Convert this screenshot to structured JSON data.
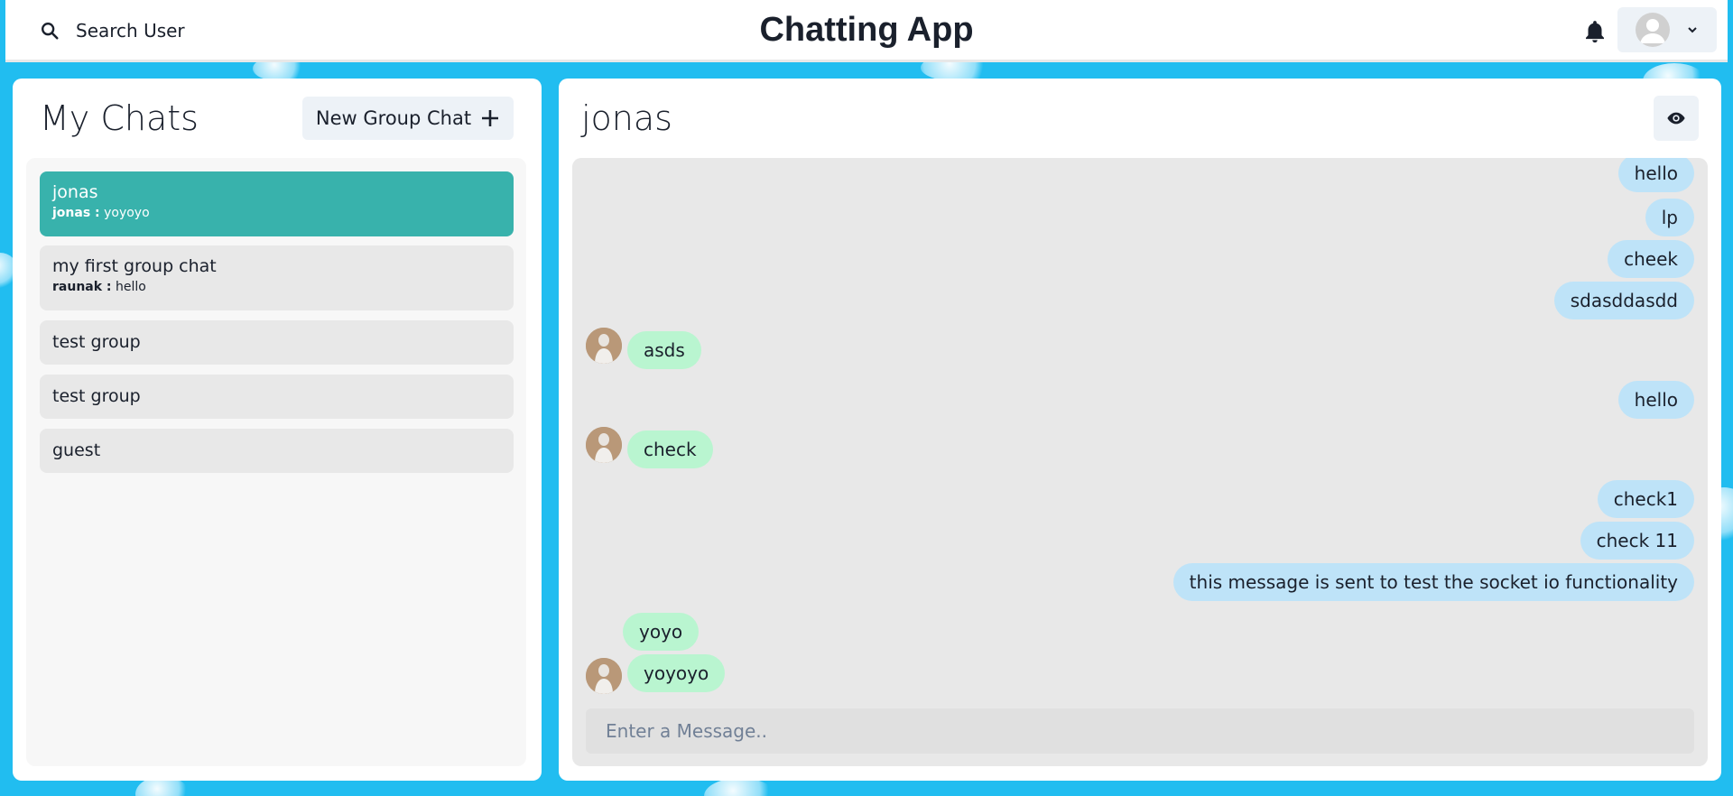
{
  "header": {
    "search_label": "Search User",
    "title": "Chatting App",
    "icons": {
      "search": "search-icon",
      "notification": "bell-icon",
      "profile": "user-avatar-icon",
      "dropdown": "chevron-down-icon"
    }
  },
  "sidebar": {
    "title": "My Chats",
    "new_group_label": "New Group Chat",
    "chats": [
      {
        "name": "jonas",
        "latest_sender": "jonas :",
        "latest_text": " yoyoyo",
        "active": true
      },
      {
        "name": "my first group chat",
        "latest_sender": "raunak :",
        "latest_text": " hello",
        "active": false
      },
      {
        "name": "test group",
        "active": false
      },
      {
        "name": "test group",
        "active": false
      },
      {
        "name": "guest",
        "active": false
      }
    ]
  },
  "chat": {
    "name": "jonas",
    "view_profile_icon": "eye-icon",
    "messages": [
      {
        "text": "hello",
        "side": "sent"
      },
      {
        "text": "lp",
        "side": "sent"
      },
      {
        "text": "cheek",
        "side": "sent"
      },
      {
        "text": "sdasddasdd",
        "side": "sent"
      },
      {
        "text": "asds",
        "side": "recv",
        "avatar": true
      },
      {
        "text": "hello",
        "side": "sent"
      },
      {
        "text": "check",
        "side": "recv",
        "avatar": true
      },
      {
        "text": "check1",
        "side": "sent"
      },
      {
        "text": "check 11",
        "side": "sent"
      },
      {
        "text": "this message is sent to test the socket io functionality",
        "side": "sent"
      },
      {
        "text": "yoyo",
        "side": "recv",
        "avatar": false
      },
      {
        "text": "yoyoyo",
        "side": "recv",
        "avatar": true
      }
    ],
    "input_placeholder": "Enter a Message..",
    "input_value": ""
  },
  "colors": {
    "background": "#21bdf0",
    "active_chat": "#38b2ac",
    "sent_bubble": "#bee3f8",
    "received_bubble": "#b9f5d0"
  }
}
